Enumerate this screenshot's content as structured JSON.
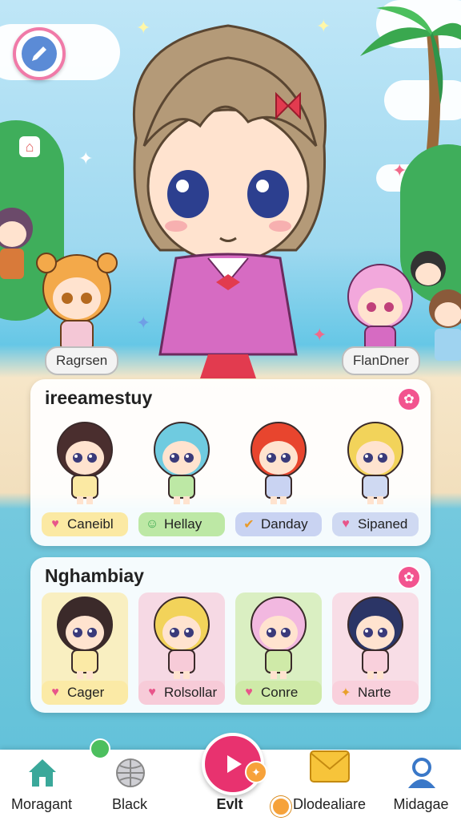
{
  "hero": {
    "left_label": "Ragrsen",
    "right_label": "FlanDner"
  },
  "panels": [
    {
      "title": "ireeamestuy",
      "characters": [
        {
          "label": "Caneibl",
          "icon": "heart-icon",
          "color": "#fbe9a3",
          "hair": "#4a2e2e"
        },
        {
          "label": "Hellay",
          "icon": "face-icon",
          "color": "#bde8a5",
          "hair": "#6fcbe0"
        },
        {
          "label": "Danday",
          "icon": "check-icon",
          "color": "#c9d3f2",
          "hair": "#e8452e"
        },
        {
          "label": "Sipaned",
          "icon": "heart-icon",
          "color": "#cfd9f2",
          "hair": "#f2d35a"
        }
      ]
    },
    {
      "title": "Nghambiay",
      "characters": [
        {
          "label": "Cager",
          "icon": "heart-icon",
          "color": "#fbeaa6",
          "hair": "#3b2a2a"
        },
        {
          "label": "Rolsollar",
          "icon": "heart-icon",
          "color": "#f7cbd8",
          "hair": "#f2d35a"
        },
        {
          "label": "Conre",
          "icon": "heart-icon",
          "color": "#cfeaa8",
          "hair": "#f2b8e0"
        },
        {
          "label": "Narte",
          "icon": "star-icon",
          "color": "#f9d0dc",
          "hair": "#2b3566"
        }
      ]
    }
  ],
  "nav": [
    {
      "label": "Moragant",
      "icon": "house-icon"
    },
    {
      "label": "Black",
      "icon": "globe-icon"
    },
    {
      "label": "Evlt",
      "icon": "play-icon"
    },
    {
      "label": "Dlodealiare",
      "icon": "mail-icon"
    },
    {
      "label": "Midagae",
      "icon": "person-icon"
    }
  ],
  "colors": {
    "accent": "#e8326f",
    "badge": "#f2548f"
  }
}
